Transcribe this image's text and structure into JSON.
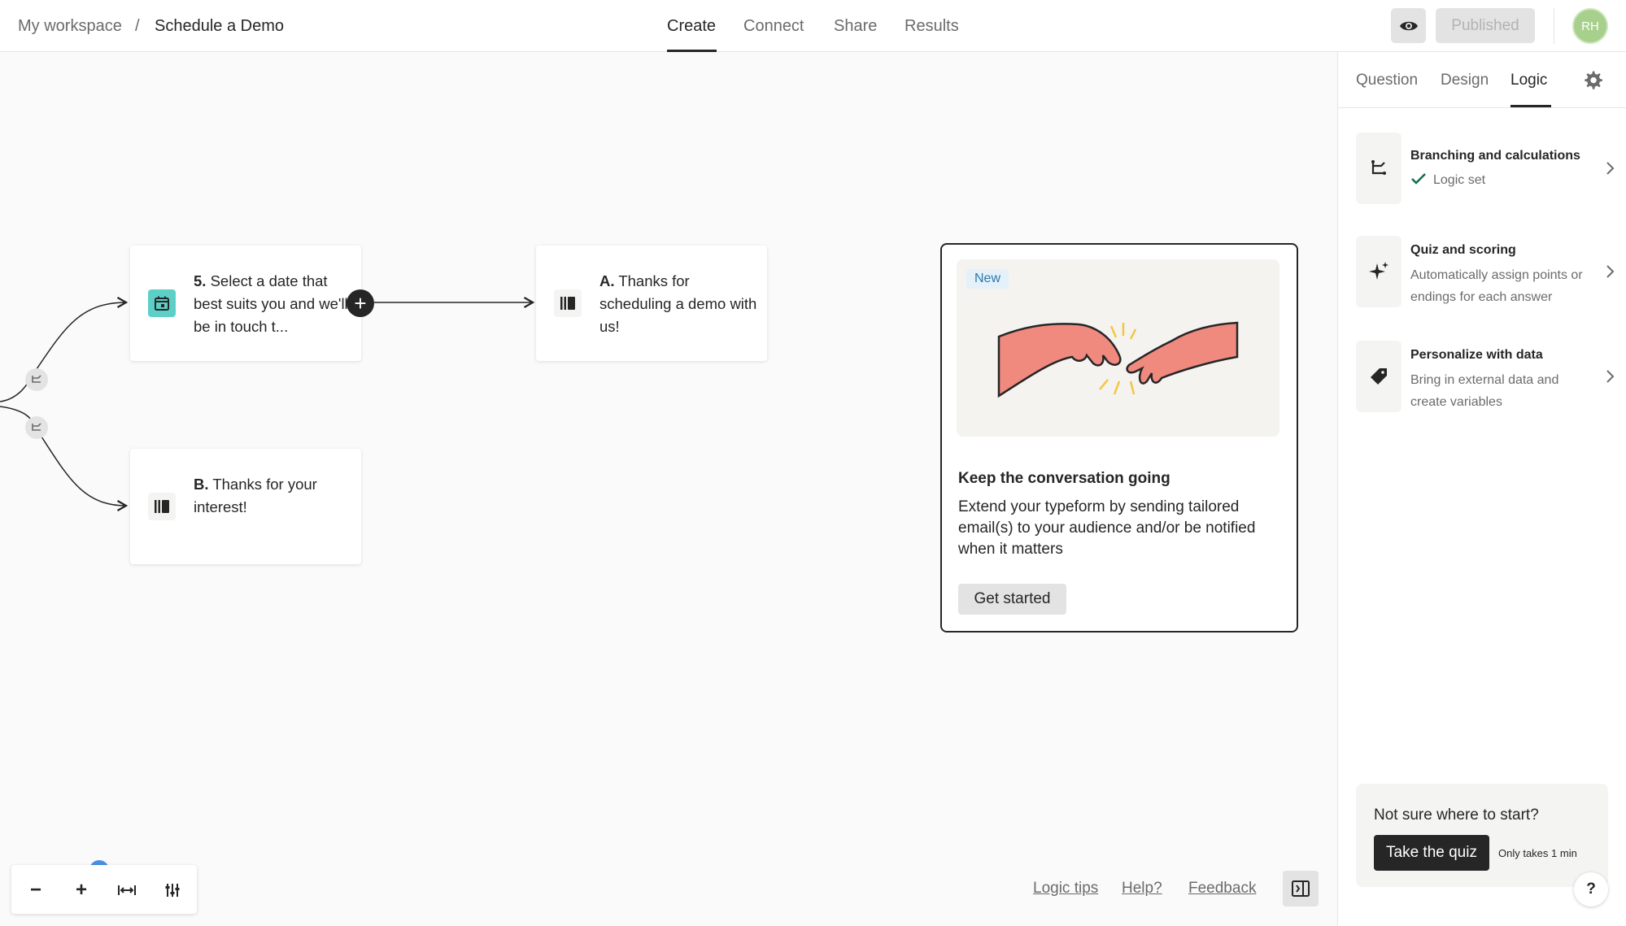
{
  "breadcrumb": {
    "workspace": "My workspace",
    "separator": "/",
    "form_title": "Schedule a Demo"
  },
  "nav": {
    "tabs": [
      {
        "label": "Create"
      },
      {
        "label": "Connect"
      },
      {
        "label": "Share"
      },
      {
        "label": "Results"
      }
    ],
    "active": "Create"
  },
  "header": {
    "published_label": "Published",
    "avatar_initials": "RH",
    "avatar_color": "#a8d08d"
  },
  "panel": {
    "tabs": [
      {
        "label": "Question"
      },
      {
        "label": "Design"
      },
      {
        "label": "Logic"
      }
    ],
    "active": "Logic",
    "items": [
      {
        "title": "Branching and calculations",
        "status": "Logic set",
        "icon": "branch-icon"
      },
      {
        "title": "Quiz and scoring",
        "desc": "Automatically assign points or endings for each answer",
        "icon": "sparkle-icon"
      },
      {
        "title": "Personalize with data",
        "desc": "Bring in external data and create variables",
        "icon": "tag-icon"
      }
    ],
    "quiz": {
      "question": "Not sure where to start?",
      "button": "Take the quiz",
      "note": "Only takes 1 min"
    },
    "help_label": "?"
  },
  "canvas": {
    "nodes": [
      {
        "number": "5.",
        "text": "Select a date that best suits you and we'll be in touch t...",
        "icon": "calendar-icon",
        "icon_color": "#5ccfc7"
      },
      {
        "number": "A.",
        "text": "Thanks for scheduling a demo with us!",
        "icon": "ending-icon"
      },
      {
        "number": "B.",
        "text": "Thanks for your interest!",
        "icon": "ending-icon"
      }
    ],
    "add_label": "+"
  },
  "promo": {
    "badge": "New",
    "title": "Keep the conversation going",
    "body": "Extend your typeform by sending tailored email(s) to your audience and/or be notified when it matters",
    "button": "Get started"
  },
  "footer": {
    "logic_tips": "Logic tips",
    "help": "Help?",
    "feedback": "Feedback"
  },
  "zoom": {
    "out": "−",
    "in": "+"
  }
}
